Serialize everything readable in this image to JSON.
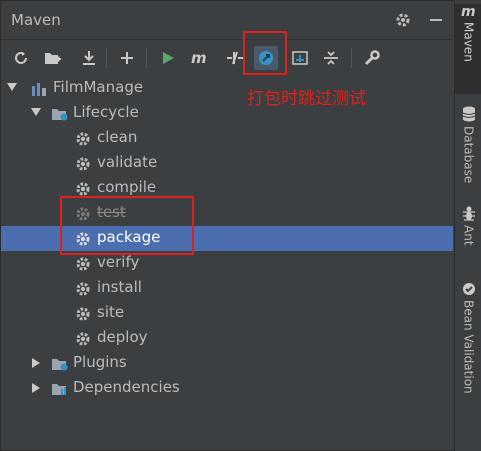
{
  "panel": {
    "title": "Maven"
  },
  "toolbar": {
    "items": [
      "reload-all",
      "add-project",
      "download-sources",
      "add",
      "run",
      "execute-goal",
      "toggle-offline",
      "skip-tests",
      "show-dependencies",
      "collapse-all",
      "settings"
    ]
  },
  "tree": {
    "project": "FilmManage",
    "lifecycle": "Lifecycle",
    "phases": [
      "clean",
      "validate",
      "compile",
      "test",
      "package",
      "verify",
      "install",
      "site",
      "deploy"
    ],
    "plugins": "Plugins",
    "dependencies": "Dependencies"
  },
  "annotation": "打包时跳过测试",
  "sidebar": {
    "tabs": [
      "Maven",
      "Database",
      "Ant",
      "Bean Validation"
    ]
  },
  "colors": {
    "selection": "#4b6eaf",
    "annotation": "#e0201a",
    "run": "#59a869",
    "active_toggle": "#3592c4"
  }
}
